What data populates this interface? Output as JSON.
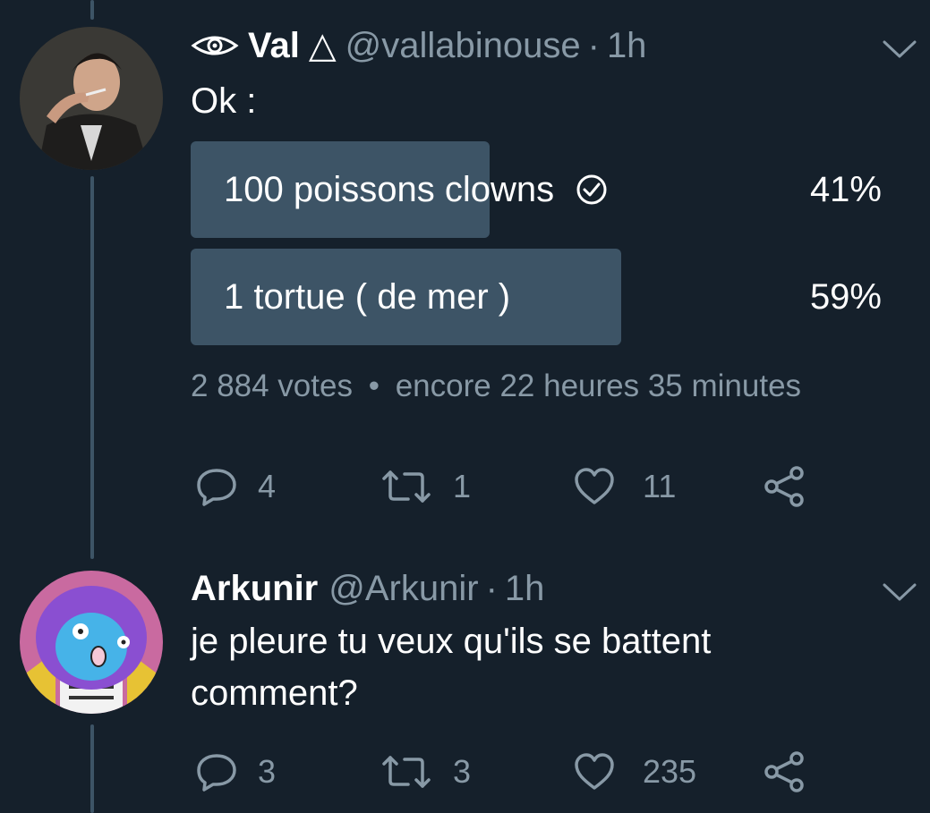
{
  "tweets": [
    {
      "display_name": "Val",
      "name_emoji": "👁",
      "name_suffix": "△",
      "handle": "@vallabinouse",
      "time": "1h",
      "text": "Ok :",
      "poll": {
        "options": [
          {
            "label": "100 poissons clowns",
            "percent_label": "41%",
            "share": 0.41,
            "selected": true
          },
          {
            "label": "1 tortue ( de mer )",
            "percent_label": "59%",
            "share": 0.59,
            "selected": false
          }
        ],
        "votes": "2 884 votes",
        "remaining": "encore 22 heures 35 minutes"
      },
      "actions": {
        "replies": "4",
        "retweets": "1",
        "likes": "11"
      }
    },
    {
      "display_name": "Arkunir",
      "handle": "@Arkunir",
      "time": "1h",
      "text_line1": "je pleure tu veux qu'ils se battent",
      "text_line2": "comment?",
      "actions": {
        "replies": "3",
        "retweets": "3",
        "likes": "235"
      }
    }
  ],
  "separator": "·",
  "poll_separator": "•",
  "colors": {
    "background": "#15202b",
    "secondary_text": "#8899a6",
    "poll_bar": "#3d5466"
  },
  "icons": [
    "eye-icon",
    "chevron-down-icon",
    "check-circle-icon",
    "reply-icon",
    "retweet-icon",
    "like-icon",
    "share-icon"
  ]
}
